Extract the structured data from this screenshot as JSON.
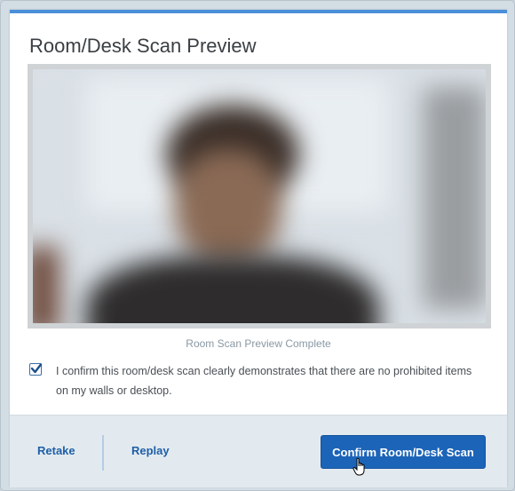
{
  "dialog": {
    "title": "Room/Desk Scan Preview",
    "status": "Room Scan Preview Complete",
    "confirm_checked": true,
    "confirm_text": "I confirm this room/desk scan clearly demonstrates that there are no prohibited items on my walls or desktop."
  },
  "footer": {
    "retake_label": "Retake",
    "replay_label": "Replay",
    "confirm_label": "Confirm Room/Desk Scan"
  },
  "colors": {
    "accent": "#1c64b8",
    "link": "#1f5fa8",
    "modal_top_border": "#4a90d9"
  }
}
